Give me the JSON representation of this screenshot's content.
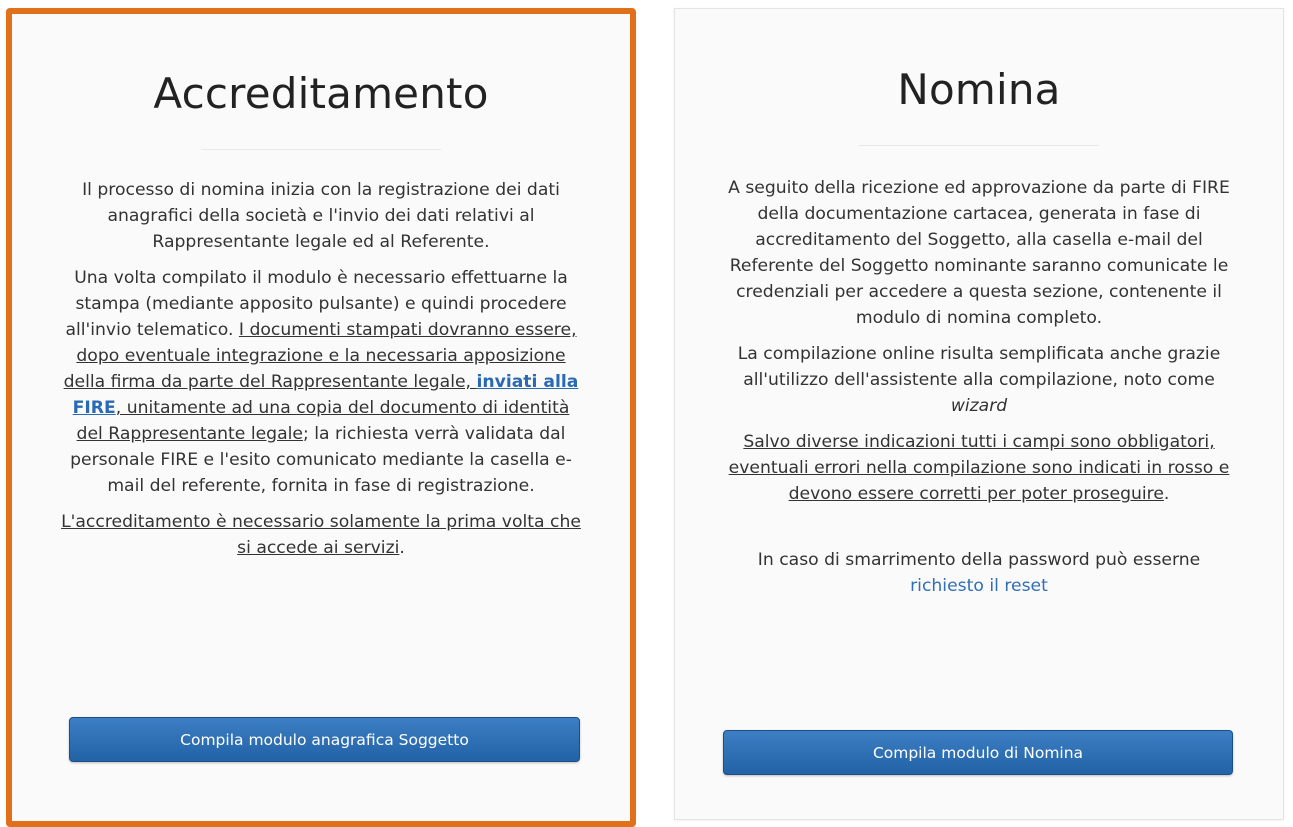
{
  "left_card": {
    "title": "Accreditamento",
    "p1": "Il processo di nomina inizia con la registrazione dei dati anagrafici della società e l'invio dei dati relativi al Rappresentante legale ed al Referente.",
    "p2_a": "Una volta compilato il modulo è necessario effettuarne la stampa (mediante apposito pulsante) e quindi procedere all'invio telematico. ",
    "p2_u1": "I documenti stampati dovranno essere, dopo eventuale integrazione e la necessaria apposizione della firma da parte del Rappresentante legale, ",
    "p2_link": "inviati alla FIRE",
    "p2_u2": ", unitamente ad una copia del documento di identità del Rappresentante legale",
    "p2_b": "; la richiesta verrà validata dal personale FIRE e l'esito comunicato mediante la casella e-mail del referente, fornita in fase di registrazione.",
    "p3_u": "L'accreditamento è necessario solamente la prima volta che si accede ai servizi",
    "p3_end": ".",
    "button_label": "Compila modulo anagrafica Soggetto",
    "highlight_color": "#e0701a"
  },
  "right_card": {
    "title": "Nomina",
    "p1": "A seguito della ricezione ed approvazione da parte di FIRE della documentazione cartacea, generata in fase di accreditamento del Soggetto, alla casella e-mail del Referente del Soggetto nominante saranno comunicate le credenziali per accedere a questa sezione, contenente il modulo di nomina completo.",
    "p2_a": "La compilazione online risulta semplificata anche grazie all'utilizzo dell'assistente alla compilazione, noto come ",
    "p2_em": "wizard",
    "p3_u": "Salvo diverse indicazioni tutti i campi sono obbligatori, eventuali errori nella compilazione sono indicati in rosso e devono essere corretti per poter proseguire",
    "p3_end": ".",
    "p4_a": "In caso di smarrimento della password può esserne",
    "p4_link": "richiesto il reset",
    "button_label": "Compila modulo di Nomina"
  },
  "colors": {
    "button_bg": "#2d6db1",
    "link": "#2f6fb6"
  }
}
